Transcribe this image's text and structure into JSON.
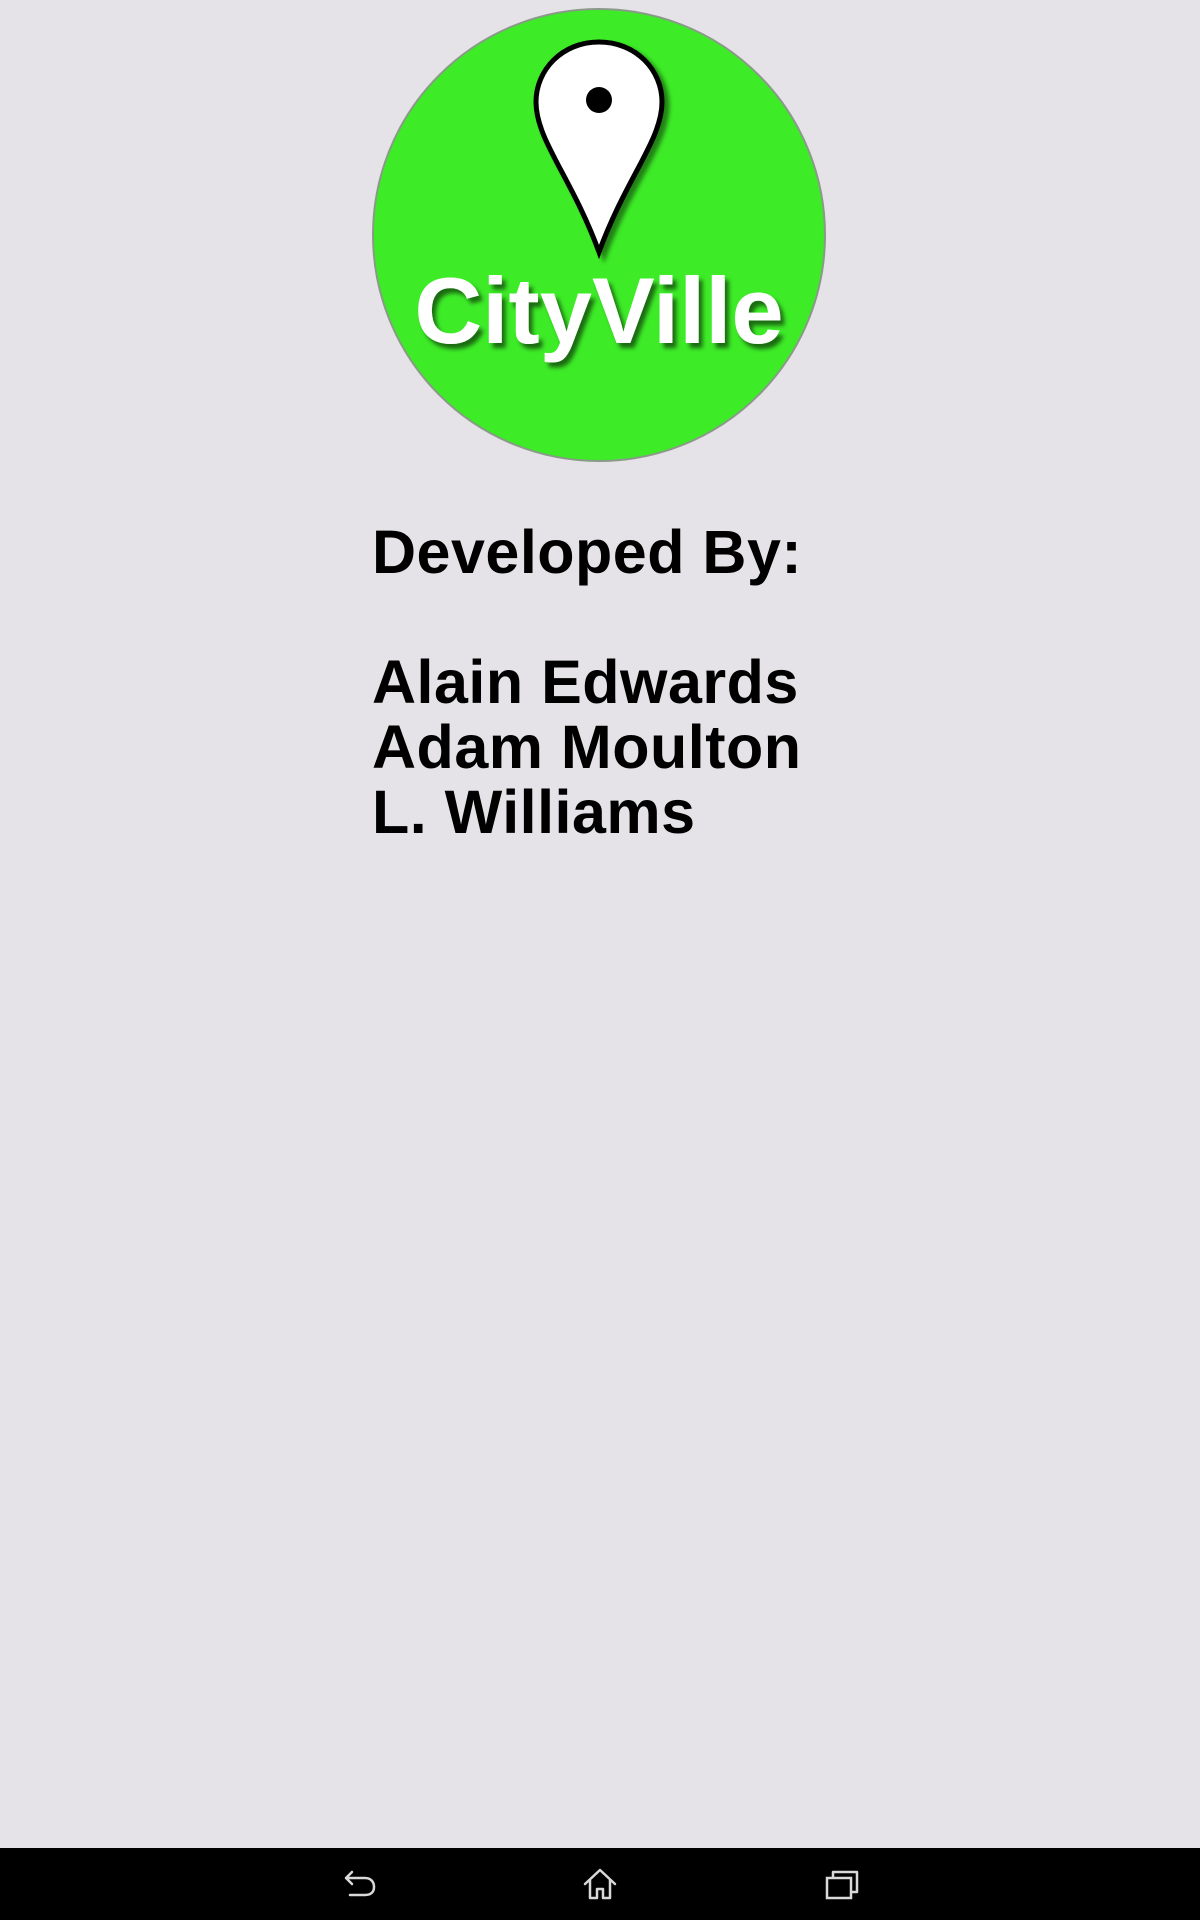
{
  "app": {
    "logo_text": "CityVille",
    "brand_color": "#3deb27",
    "icon": "map-pin-icon"
  },
  "credits": {
    "heading": "Developed By:",
    "developers": [
      "Alain Edwards",
      "Adam Moulton",
      "L. Williams"
    ]
  },
  "navbar": {
    "back_icon": "back-icon",
    "home_icon": "home-icon",
    "recent_icon": "recent-apps-icon"
  }
}
